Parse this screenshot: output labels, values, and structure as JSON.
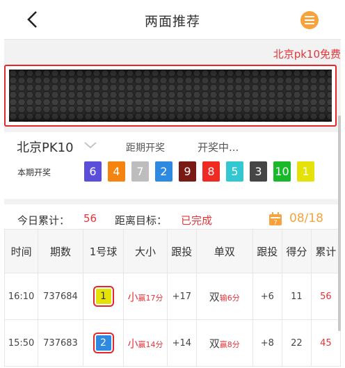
{
  "header": {
    "title": "两面推荐",
    "back_icon": "chevron-left-icon",
    "menu_icon": "menu-icon"
  },
  "marquee": "北京pk10免费",
  "lottery": {
    "name": "北京PK10",
    "distance_label": "距期开奖",
    "status": "开奖中...",
    "current_label": "本期开奖",
    "balls": [
      {
        "n": "6",
        "color": "#5b4fd9"
      },
      {
        "n": "4",
        "color": "#f5830f"
      },
      {
        "n": "7",
        "color": "#bdbdbd"
      },
      {
        "n": "2",
        "color": "#2d8ae0"
      },
      {
        "n": "9",
        "color": "#7a1a14"
      },
      {
        "n": "8",
        "color": "#f02b24"
      },
      {
        "n": "5",
        "color": "#33c8d1"
      },
      {
        "n": "3",
        "color": "#454545"
      },
      {
        "n": "10",
        "color": "#1ab92b"
      },
      {
        "n": "1",
        "color": "#e5e20a"
      }
    ]
  },
  "summary": {
    "today_label": "今日累计：",
    "today_value": "56",
    "target_label": "距离目标：",
    "target_value": "已完成",
    "date": "08/18"
  },
  "table": {
    "headers": [
      "时间",
      "期数",
      "1号球",
      "大小",
      "跟投",
      "单双",
      "跟投",
      "得分",
      "累计"
    ],
    "rows": [
      {
        "time": "16:10",
        "issue": "737684",
        "ball": "1",
        "ball_color": "#e5e20a",
        "ball_text_color": "#333",
        "size": "小",
        "size_note": "赢17分",
        "follow1": "+17",
        "parity": "双",
        "parity_note": "输6分",
        "follow2": "+6",
        "score": "11",
        "total": "56"
      },
      {
        "time": "15:50",
        "issue": "737683",
        "ball": "2",
        "ball_color": "#2d8ae0",
        "ball_text_color": "#fff",
        "size": "小",
        "size_note": "赢14分",
        "follow1": "+14",
        "parity": "双",
        "parity_note": "赢8分",
        "follow2": "+8",
        "score": "22",
        "total": "45"
      }
    ]
  }
}
